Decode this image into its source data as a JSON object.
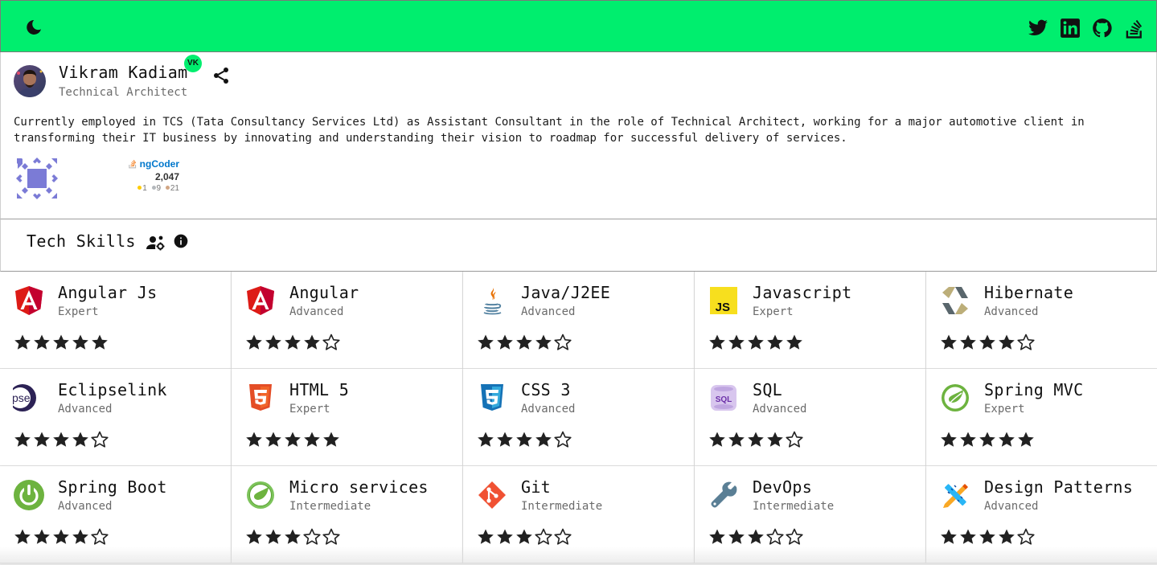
{
  "toolbar": {
    "background": "#00ee6e",
    "theme_toggle_icon": "moon-icon",
    "social_links": [
      {
        "name": "twitter",
        "icon": "twitter-icon"
      },
      {
        "name": "linkedin",
        "icon": "linkedin-icon"
      },
      {
        "name": "github",
        "icon": "github-icon"
      },
      {
        "name": "stackoverflow",
        "icon": "stackoverflow-icon"
      }
    ]
  },
  "profile": {
    "name": "Vikram Kadiam",
    "badge": "VK",
    "role": "Technical Architect",
    "bio": "Currently employed in TCS (Tata Consultancy Services Ltd) as Assistant Consultant in the role of Technical Architect, working for a major automotive client in transforming their IT business by innovating and understanding their vision to roadmap for successful delivery of services.",
    "stackoverflow_flair": {
      "username": "ngCoder",
      "reputation": "2,047",
      "gold": "1",
      "silver": "9",
      "bronze": "21"
    }
  },
  "skills_section": {
    "title": "Tech Skills"
  },
  "skills": [
    {
      "name": "Angular Js",
      "level": "Expert",
      "rating": 5,
      "icon": "angularjs-icon"
    },
    {
      "name": "Angular",
      "level": "Advanced",
      "rating": 4,
      "icon": "angular-icon"
    },
    {
      "name": "Java/J2EE",
      "level": "Advanced",
      "rating": 4,
      "icon": "java-icon"
    },
    {
      "name": "Javascript",
      "level": "Expert",
      "rating": 5,
      "icon": "javascript-icon"
    },
    {
      "name": "Hibernate",
      "level": "Advanced",
      "rating": 4,
      "icon": "hibernate-icon"
    },
    {
      "name": "Eclipselink",
      "level": "Advanced",
      "rating": 4,
      "icon": "eclipse-icon"
    },
    {
      "name": "HTML 5",
      "level": "Expert",
      "rating": 5,
      "icon": "html5-icon"
    },
    {
      "name": "CSS 3",
      "level": "Advanced",
      "rating": 4,
      "icon": "css3-icon"
    },
    {
      "name": "SQL",
      "level": "Advanced",
      "rating": 4,
      "icon": "sql-icon"
    },
    {
      "name": "Spring MVC",
      "level": "Expert",
      "rating": 5,
      "icon": "spring-icon"
    },
    {
      "name": "Spring Boot",
      "level": "Advanced",
      "rating": 4,
      "icon": "spring-boot-icon"
    },
    {
      "name": "Micro services",
      "level": "Intermediate",
      "rating": 3,
      "icon": "spring-cloud-icon"
    },
    {
      "name": "Git",
      "level": "Intermediate",
      "rating": 3,
      "icon": "git-icon"
    },
    {
      "name": "DevOps",
      "level": "Intermediate",
      "rating": 3,
      "icon": "wrench-icon"
    },
    {
      "name": "Design Patterns",
      "level": "Advanced",
      "rating": 4,
      "icon": "design-tools-icon"
    }
  ]
}
